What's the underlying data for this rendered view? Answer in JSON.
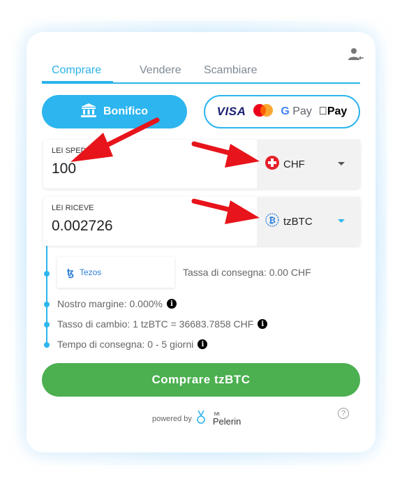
{
  "tabs": [
    {
      "label": "Comprare",
      "active": true
    },
    {
      "label": "Vendere",
      "active": false
    },
    {
      "label": "Scambiare",
      "active": false
    }
  ],
  "payment": {
    "bank_label": "Bonifico",
    "card_brands": {
      "visa": "VISA",
      "gpay": "Pay",
      "gpay_g": "G",
      "apay": "Pay"
    }
  },
  "send": {
    "label": "LEI SPED",
    "value": "100",
    "currency": "CHF"
  },
  "receive": {
    "label": "LEI RICEVE",
    "value": "0.002726",
    "currency": "tzBTC"
  },
  "network": {
    "label": "Tezos",
    "glyph": "ꜩ"
  },
  "details": {
    "fee": "Tassa di consegna: 0.00 CHF",
    "margin": "Nostro margine: 0.000%",
    "rate": "Tasso di cambio: 1 tzBTC = 36683.7858 CHF",
    "time": "Tempo di consegna: 0 - 5 giorni"
  },
  "cta_label": "Comprare tzBTC",
  "footer": {
    "powered_by": "powered by",
    "brand_mt": "Mt",
    "brand_name": "Pelerin",
    "help": "?"
  },
  "colors": {
    "accent": "#2cb5ee",
    "cta": "#4caf50",
    "arrow": "#e8141b"
  },
  "icons": [
    "user-icon",
    "bank-icon",
    "swiss-flag-icon",
    "bitcoin-icon",
    "info-icon",
    "help-icon",
    "arrow-annotation"
  ]
}
